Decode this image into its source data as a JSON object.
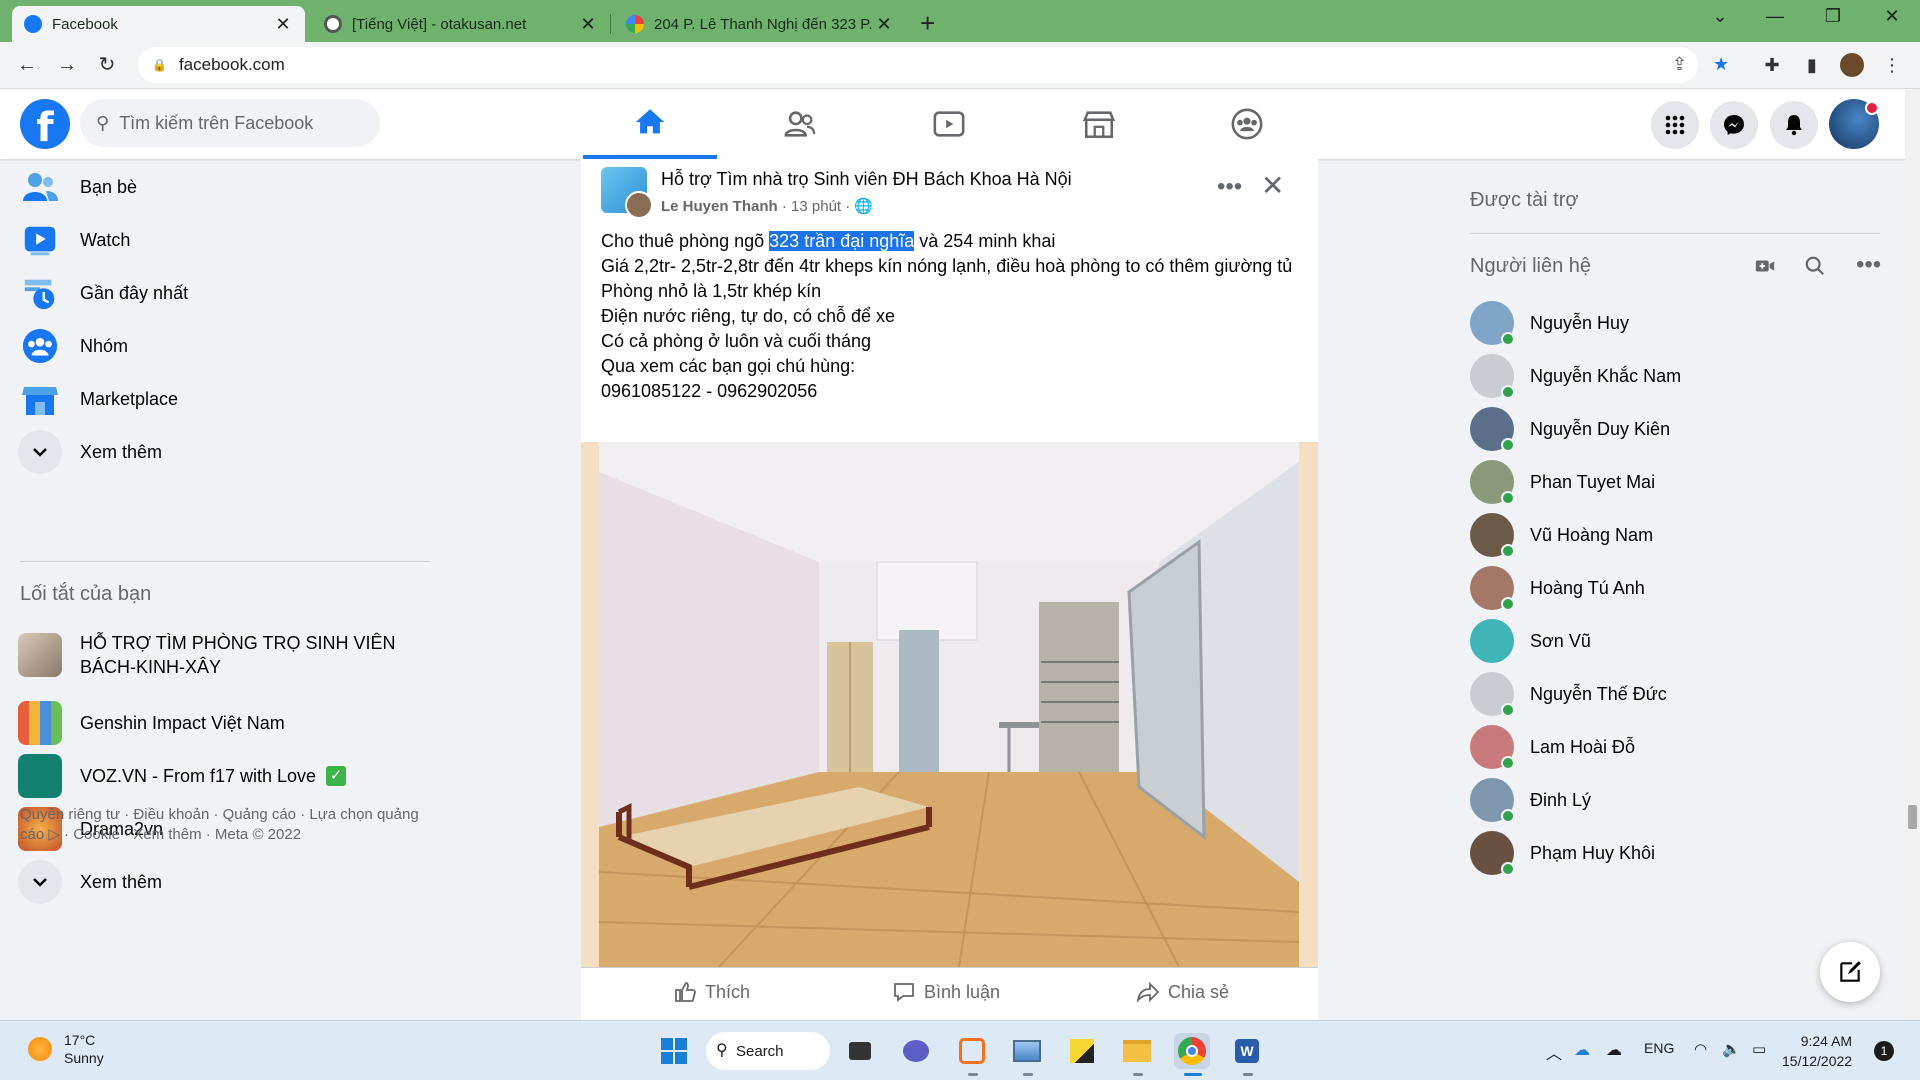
{
  "browser": {
    "tabs": [
      {
        "title": "Facebook",
        "favicon_color": "#1877f2"
      },
      {
        "title": "[Tiếng Việt] - otakusan.net",
        "favicon_color": "#555555"
      },
      {
        "title": "204 P. Lê Thanh Nghị đến 323 P.",
        "favicon_color": "#34a853"
      }
    ],
    "url": "facebook.com"
  },
  "header": {
    "search_placeholder": "Tìm kiếm trên Facebook",
    "nav_tabs": [
      "home",
      "friends",
      "watch",
      "marketplace",
      "groups"
    ],
    "active_tab": "home"
  },
  "sidebar": {
    "items": [
      {
        "label": "Bạn bè",
        "icon": "friends-icon"
      },
      {
        "label": "Watch",
        "icon": "watch-icon"
      },
      {
        "label": "Gần đây nhất",
        "icon": "recent-icon"
      },
      {
        "label": "Nhóm",
        "icon": "groups-icon"
      },
      {
        "label": "Marketplace",
        "icon": "marketplace-icon"
      },
      {
        "label": "Xem thêm",
        "icon": "chevron-down-icon"
      }
    ],
    "shortcuts_heading": "Lối tắt của bạn",
    "shortcuts": [
      {
        "label": "HỖ TRỢ TÌM PHÒNG TRỌ SINH VIÊN BÁCH-KINH-XÂY"
      },
      {
        "label": "Genshin Impact Việt Nam"
      },
      {
        "label": "VOZ.VN - From f17 with Love"
      },
      {
        "label": "Drama2vn"
      },
      {
        "label": "Xem thêm"
      }
    ],
    "footer": "Quyền riêng tư · Điều khoản · Quảng cáo · Lựa chọn quảng cáo ▷ · Cookie · Xem thêm · Meta © 2022"
  },
  "post": {
    "group": "Hỗ trợ Tìm nhà trọ Sinh viên ĐH Bách Khoa Hà Nội",
    "author": "Le Huyen Thanh",
    "time": "13 phút",
    "text_line1_before": "Cho thuê phòng ngõ ",
    "text_line1_highlight": "323 trần đại nghĩa",
    "text_line1_after": " và 254 minh khai",
    "text_rest": [
      "Giá 2,2tr- 2,5tr-2,8tr đến 4tr kheps kín nóng lạnh, điều hoà phòng to có thêm giường tủ",
      "Phòng nhỏ là 1,5tr khép kín",
      "Điện nước riêng, tự do, có chỗ để xe",
      "Có cả phòng ở luôn và cuối tháng",
      "Qua xem các bạn gọi chú hùng:",
      "0961085122 - 0962902056"
    ],
    "actions": {
      "like": "Thích",
      "comment": "Bình luận",
      "share": "Chia sẻ"
    }
  },
  "rightcol": {
    "sponsored": "Được tài trợ",
    "contacts_heading": "Người liên hệ",
    "contacts": [
      {
        "name": "Nguyễn Huy",
        "color": "#7fa6c9"
      },
      {
        "name": "Nguyễn Khắc Nam",
        "color": "#c9ccd1"
      },
      {
        "name": "Nguyễn Duy Kiên",
        "color": "#5b6f8a"
      },
      {
        "name": "Phan Tuyet Mai",
        "color": "#8a9a7a"
      },
      {
        "name": "Vũ Hoàng Nam",
        "color": "#6b5a48"
      },
      {
        "name": "Hoàng Tú Anh",
        "color": "#a37866"
      },
      {
        "name": "Sơn Vũ",
        "color": "#3fb5b8"
      },
      {
        "name": "Nguyễn Thế Đức",
        "color": "#c9ccd1"
      },
      {
        "name": "Lam Hoài Đỗ",
        "color": "#c97a7a"
      },
      {
        "name": "Đinh Lý",
        "color": "#7f98b0"
      },
      {
        "name": "Phạm Huy Khôi",
        "color": "#6a5040"
      }
    ]
  },
  "taskbar": {
    "temp": "17°C",
    "condition": "Sunny",
    "search": "Search",
    "lang": "ENG",
    "time": "9:24 AM",
    "date": "15/12/2022",
    "notifications": "1"
  }
}
